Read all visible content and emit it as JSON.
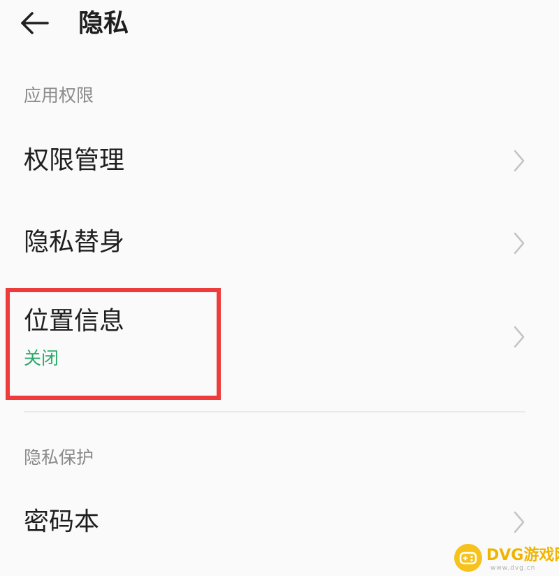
{
  "header": {
    "back_icon": "arrow-left-icon",
    "title": "隐私"
  },
  "sections": [
    {
      "title": "应用权限",
      "items": [
        {
          "label": "权限管理",
          "icon": "chevron-right-icon"
        },
        {
          "label": "隐私替身",
          "icon": "chevron-right-icon"
        },
        {
          "label": "位置信息",
          "status": "关闭",
          "icon": "chevron-right-icon"
        }
      ]
    },
    {
      "title": "隐私保护",
      "items": [
        {
          "label": "密码本",
          "icon": "chevron-right-icon"
        }
      ]
    }
  ],
  "colors": {
    "background": "#fafafa",
    "status_green": "#2aa86a",
    "highlight_red": "#ee3b3b",
    "watermark_yellow": "#f0b400"
  },
  "watermark": {
    "text": "DVG游戏网",
    "subtext": "www.dvg.cn"
  }
}
